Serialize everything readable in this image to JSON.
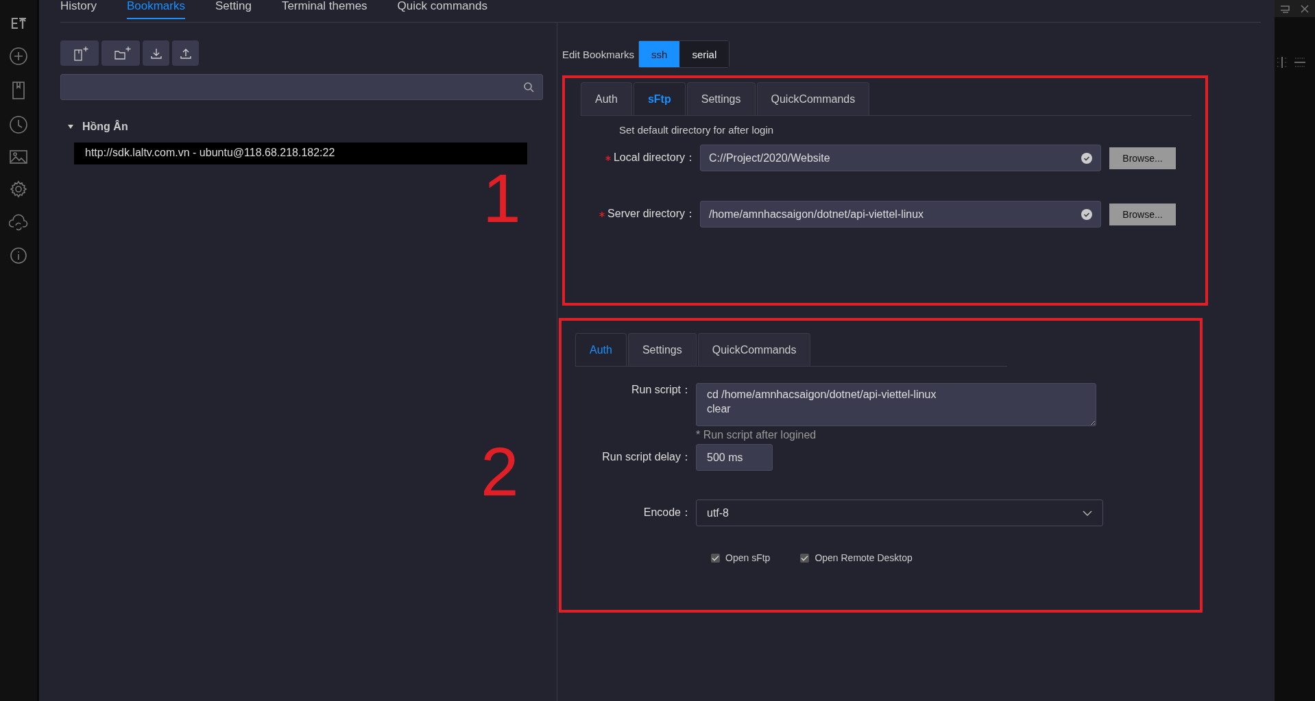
{
  "top_tabs": [
    {
      "label": "History",
      "selected": false
    },
    {
      "label": "Bookmarks",
      "selected": true
    },
    {
      "label": "Setting",
      "selected": false
    },
    {
      "label": "Terminal themes",
      "selected": false
    },
    {
      "label": "Quick commands",
      "selected": false
    }
  ],
  "tree": [
    {
      "label": "Hồng Ân",
      "expanded": true,
      "children": [
        {
          "label": "http://sdk.laltv.com.vn - ubuntu@118.68.218.182:22",
          "selected": true
        }
      ]
    }
  ],
  "edit": {
    "label": "Edit Bookmarks",
    "types": [
      {
        "label": "ssh",
        "selected": true
      },
      {
        "label": "serial",
        "selected": false
      }
    ]
  },
  "panel_1": {
    "annotation": "1",
    "tabs": [
      {
        "label": "Auth",
        "selected": false
      },
      {
        "label": "sFtp",
        "selected": true
      },
      {
        "label": "Settings",
        "selected": false
      },
      {
        "label": "QuickCommands",
        "selected": false
      }
    ],
    "hint": "Set  default directory for after login",
    "fields": [
      {
        "label": "Local directory：",
        "required": true,
        "value": "C://Project/2020/Website",
        "button": "Browse..."
      },
      {
        "label": "Server directory：",
        "required": true,
        "value": "/home/amnhacsaigon/dotnet/api-viettel-linux",
        "button": "Browse..."
      }
    ]
  },
  "panel_2": {
    "annotation": "2",
    "tabs": [
      {
        "label": "Auth",
        "selected": true
      },
      {
        "label": "Settings",
        "selected": false
      },
      {
        "label": "QuickCommands",
        "selected": false
      }
    ],
    "run_script": {
      "label": "Run script：",
      "value": "cd /home/amnhacsaigon/dotnet/api-viettel-linux\nclear",
      "hint": "* Run script after logined"
    },
    "delay": {
      "label": "Run script delay：",
      "value": "500 ms"
    },
    "encode": {
      "label": "Encode：",
      "value": "utf-8"
    },
    "checkboxes": [
      {
        "label": "Open sFtp",
        "checked": true
      },
      {
        "label": "Open Remote Desktop",
        "checked": true
      }
    ]
  }
}
